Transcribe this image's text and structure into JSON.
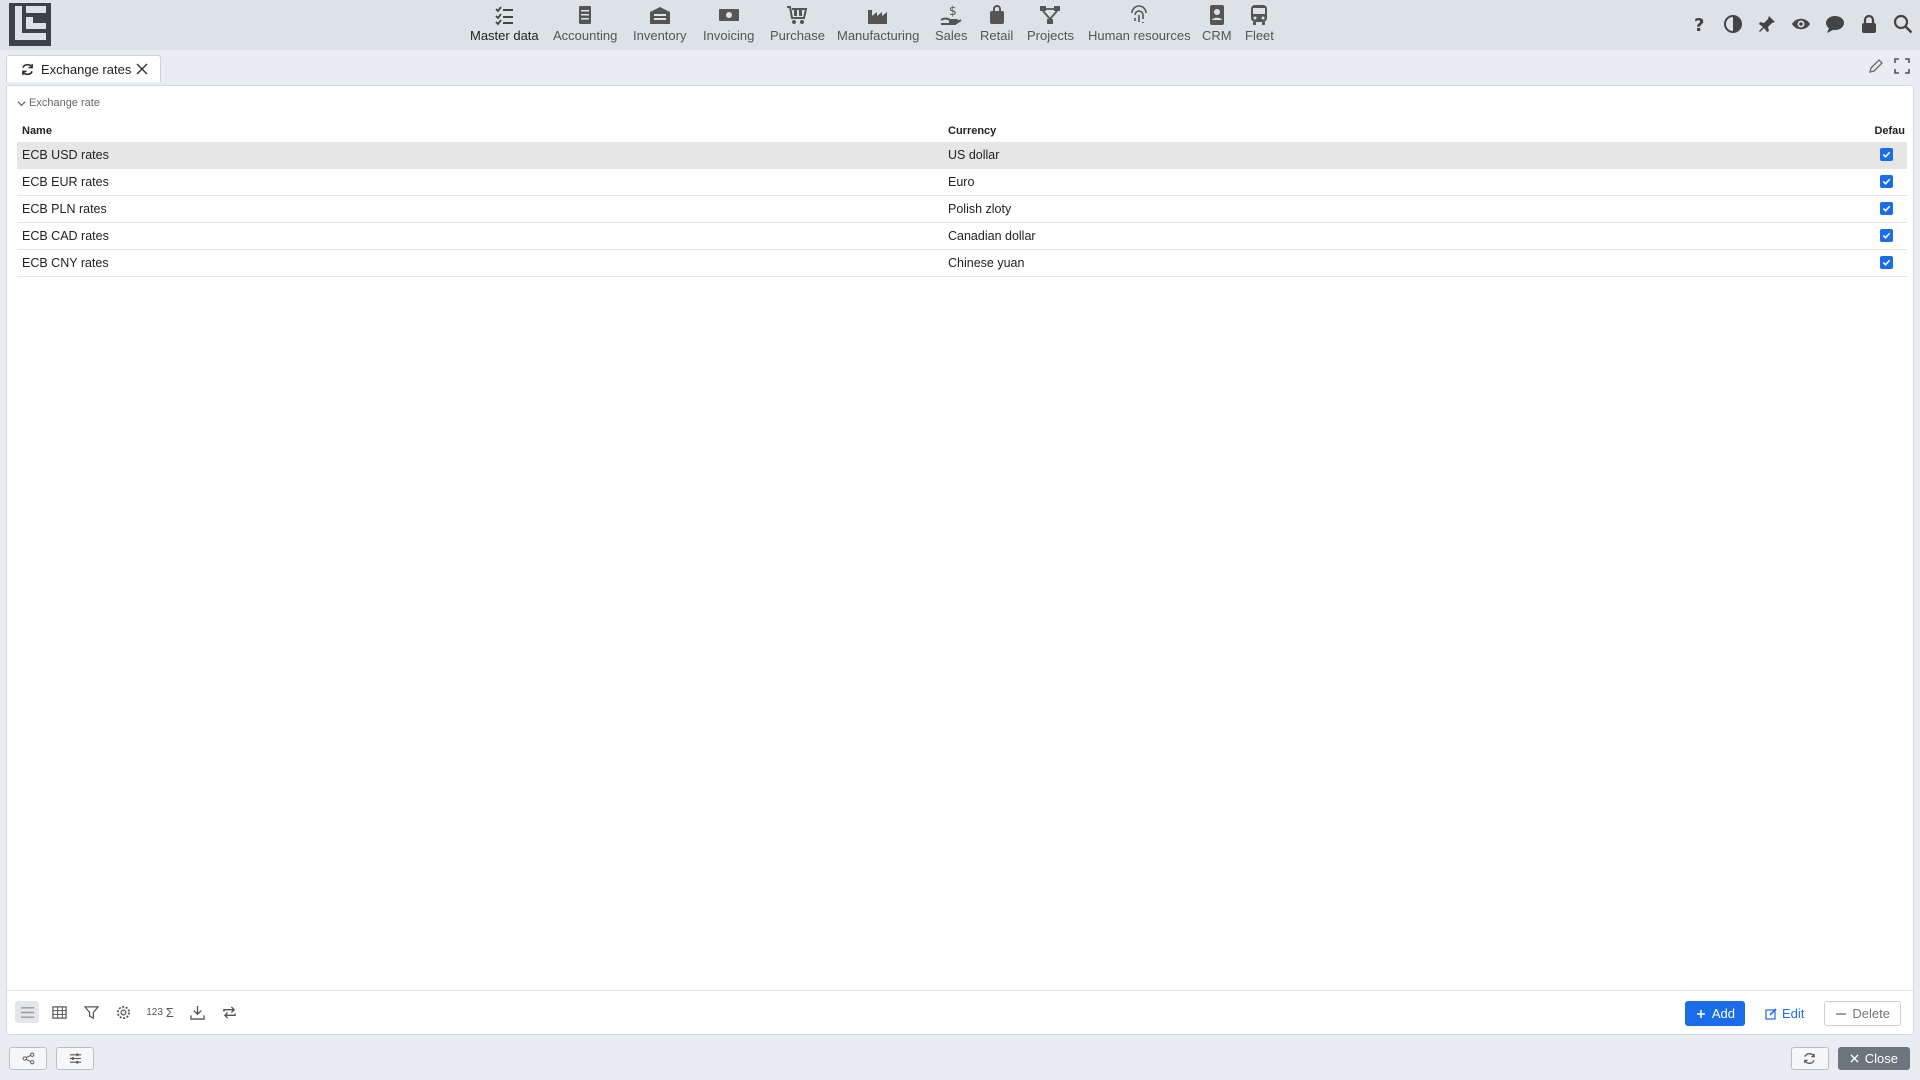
{
  "nav": {
    "modules": [
      {
        "label": "Master data",
        "icon": "checklist-icon",
        "active": true
      },
      {
        "label": "Accounting",
        "icon": "ledger-icon"
      },
      {
        "label": "Inventory",
        "icon": "warehouse-icon"
      },
      {
        "label": "Invoicing",
        "icon": "banknote-icon"
      },
      {
        "label": "Purchase",
        "icon": "cart-icon"
      },
      {
        "label": "Manufacturing",
        "icon": "factory-icon"
      },
      {
        "label": "Sales",
        "icon": "hand-coin-icon"
      },
      {
        "label": "Retail",
        "icon": "bag-icon"
      },
      {
        "label": "Projects",
        "icon": "hierarchy-icon"
      },
      {
        "label": "Human resources",
        "icon": "fingerprint-icon"
      },
      {
        "label": "CRM",
        "icon": "contact-book-icon"
      },
      {
        "label": "Fleet",
        "icon": "bus-icon"
      }
    ],
    "right_icons": [
      "help-icon",
      "contrast-icon",
      "pin-icon",
      "eye-icon",
      "chat-icon",
      "lock-icon",
      "search-icon"
    ]
  },
  "tab": {
    "title": "Exchange rates"
  },
  "group": {
    "title": "Exchange rate"
  },
  "grid": {
    "headers": {
      "name": "Name",
      "currency": "Currency",
      "default": "Defau"
    },
    "rows": [
      {
        "name": "ECB USD rates",
        "currency": "US dollar",
        "default": true
      },
      {
        "name": "ECB EUR rates",
        "currency": "Euro",
        "default": true
      },
      {
        "name": "ECB PLN rates",
        "currency": "Polish zloty",
        "default": true
      },
      {
        "name": "ECB CAD rates",
        "currency": "Canadian dollar",
        "default": true
      },
      {
        "name": "ECB CNY rates",
        "currency": "Chinese yuan",
        "default": true
      }
    ]
  },
  "toolbar": {
    "count_label": "123",
    "add_label": "Add",
    "edit_label": "Edit",
    "delete_label": "Delete"
  },
  "footer": {
    "close_label": "Close"
  },
  "colors": {
    "accent": "#1a6ce8",
    "topbar": "#dde2e6",
    "selected_row": "#e6e6e6"
  }
}
